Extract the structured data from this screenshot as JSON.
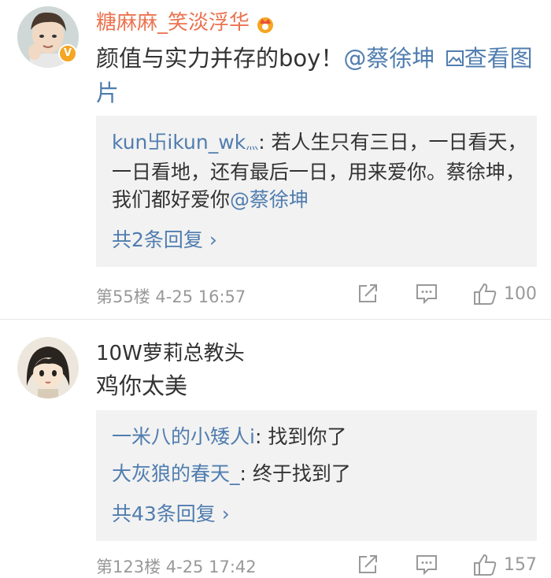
{
  "comments": [
    {
      "username": "糖麻麻_笑淡浮华",
      "text": "颜值与实力并存的boy！",
      "mention": "@蔡徐坤",
      "image_link": "查看图片",
      "reply_author": "kun卐ikun_wk",
      "reply_author_suffix": "灬",
      "reply_text": ": 若人生只有三日，一日看天，一日看地，还有最后一日，用来爱你。蔡徐坤，我们都好爱你",
      "reply_mention": "@蔡徐坤",
      "reply_count_label": "共2条回复 ›",
      "floor_time": "第55楼  4-25 16:57",
      "like_count": "100"
    },
    {
      "username": "10W萝莉总教头",
      "text": "鸡你太美",
      "replies": [
        {
          "author": "一米八的小矮人i",
          "text": ": 找到你了"
        },
        {
          "author": "大灰狼的春天_",
          "text": ": 终于找到了"
        }
      ],
      "reply_count_label": "共43条回复 ›",
      "floor_time": "第123楼  4-25 17:42",
      "like_count": "157"
    }
  ],
  "colors": {
    "username_vip": "#eb7350",
    "link": "#507daf",
    "meta": "#999999",
    "reply_bg": "#f2f2f2"
  }
}
